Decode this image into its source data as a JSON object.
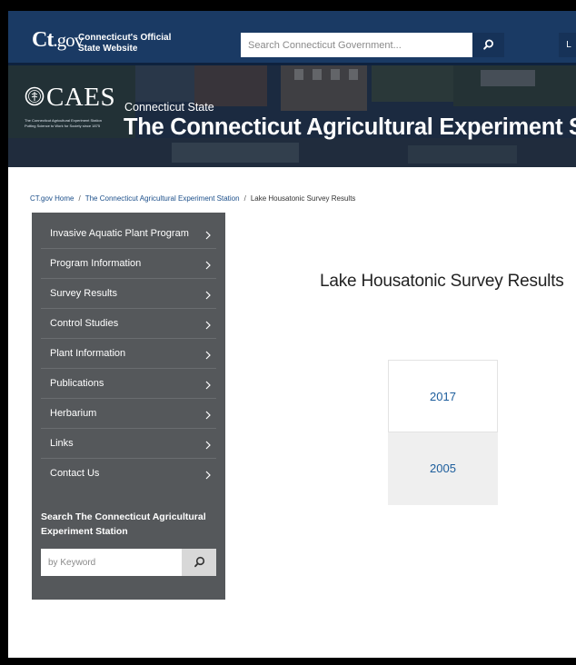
{
  "topbar": {
    "logo": {
      "ct": "Ct",
      "gov": ".gov"
    },
    "official_line1": "Connecticut's Official",
    "official_line2": "State Website",
    "search_placeholder": "Search Connecticut Government...",
    "lang_label": "L"
  },
  "banner": {
    "logo_text": "CAES",
    "logo_sub1": "The Connecticut Agricultural Experiment Station",
    "logo_sub2": "Putting Science to Work for Society since 1875",
    "kicker": "Connecticut State",
    "title": "The Connecticut Agricultural Experiment Station"
  },
  "breadcrumb": [
    {
      "label": "CT.gov Home",
      "link": true
    },
    {
      "label": "The Connecticut Agricultural Experiment Station",
      "link": true
    },
    {
      "label": "Lake Housatonic Survey Results",
      "link": false
    }
  ],
  "sidebar": {
    "items": [
      {
        "label": "Invasive Aquatic Plant Program"
      },
      {
        "label": "Program Information"
      },
      {
        "label": "Survey Results"
      },
      {
        "label": "Control Studies"
      },
      {
        "label": "Plant Information"
      },
      {
        "label": "Publications"
      },
      {
        "label": "Herbarium"
      },
      {
        "label": "Links"
      },
      {
        "label": "Contact Us"
      }
    ],
    "search_label": "Search The Connecticut Agricultural Experiment Station",
    "search_placeholder": "by Keyword"
  },
  "main": {
    "title": "Lake Housatonic Survey Results",
    "years": [
      {
        "label": "2017"
      },
      {
        "label": "2005"
      }
    ]
  },
  "colors": {
    "topbar": "#1a3a64",
    "sidebar": "#55585b",
    "link": "#1c4f8a",
    "card_alt": "#efefef"
  },
  "icons": {
    "top_search": "search-icon",
    "side_search": "search-icon",
    "nav_chevron": "chevron-right-icon",
    "logo_seal": "seal-icon"
  }
}
